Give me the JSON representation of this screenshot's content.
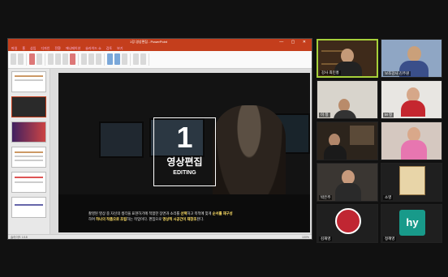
{
  "ppt": {
    "window_title": "1강-영상편집 - PowerPoint",
    "tabs": [
      "파일",
      "홈",
      "삽입",
      "디자인",
      "전환",
      "애니메이션",
      "슬라이드 쇼",
      "검토",
      "보기"
    ],
    "slide": {
      "number": "1",
      "title_ko": "영상편집",
      "title_en": "EDITING",
      "caption_line1_pre": "촬영된 영상 중 자신의 생각을 표현하기에 적합한 장면과 소리를 ",
      "caption_line1_hl1": "선택",
      "caption_line1_mid": "하고 목적에 맞게 ",
      "caption_line1_hl2": "순서를 재구성",
      "caption_line2_pre": "하여 ",
      "caption_line2_hl1": "하나의 작품으로 조립",
      "caption_line2_mid": "하는 작업이다. 편집으로 ",
      "caption_line2_hl2": "영상적 시공간이 재창조",
      "caption_line2_end": "된다."
    },
    "status_left": "슬라이드 1/18",
    "status_right": "100%"
  },
  "participants": [
    {
      "name": "강사 최민홍",
      "speaking": true
    },
    {
      "name": "보조강사 김주원",
      "speaking": false
    },
    {
      "name": "이 정",
      "speaking": false
    },
    {
      "name": "M 정",
      "speaking": false
    },
    {
      "name": "",
      "speaking": false
    },
    {
      "name": "",
      "speaking": false
    },
    {
      "name": "박은주",
      "speaking": false
    },
    {
      "name": "소영",
      "speaking": false
    },
    {
      "name": "김재영",
      "speaking": false
    },
    {
      "name": "정혜영",
      "speaking": false
    }
  ],
  "icons": {
    "mic_muted": "mic-muted-icon",
    "hy_avatar_text": "hy"
  }
}
